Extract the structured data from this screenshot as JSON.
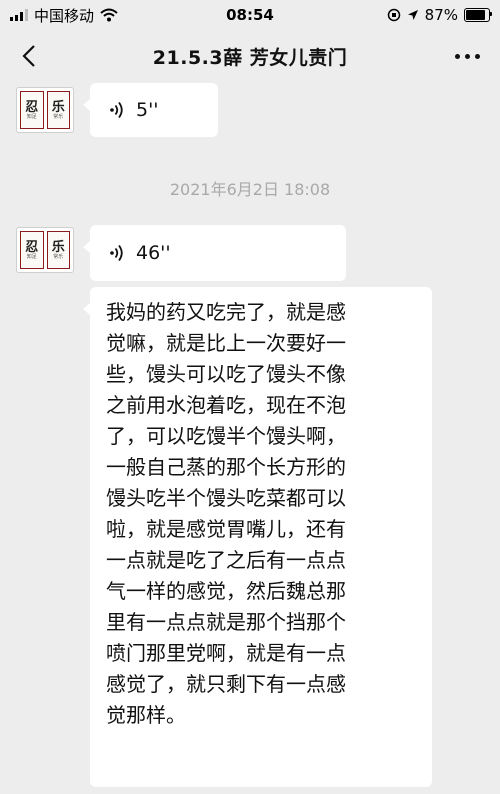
{
  "status_bar": {
    "carrier": "中国移动",
    "time": "08:54",
    "battery": "87%",
    "battery_level": 0.87
  },
  "header": {
    "title": "21.5.3薛  芳女儿责门",
    "back_icon": "chevron-left-icon",
    "more_icon": "more-dots-icon"
  },
  "messages": [
    {
      "type": "voice",
      "duration": "5''"
    },
    {
      "type": "timestamp",
      "text": "2021年6月2日 18:08"
    },
    {
      "type": "voice",
      "duration": "46''"
    },
    {
      "type": "text",
      "lines": [
        "我妈的药又吃完了，就是感",
        "觉嘛，就是比上一次要好一",
        "些，馒头可以吃了馒头不像",
        "之前用水泡着吃，现在不泡",
        "了，可以吃馒半个馒头啊，",
        "一般自己蒸的那个长方形的",
        "馒头吃半个馒头吃菜都可以",
        "啦，就是感觉胃嘴儿，还有",
        "一点就是吃了之后有一点点",
        "气一样的感觉，然后魏总那",
        "里有一点点就是那个挡那个",
        "喷门那里党啊，就是有一点",
        "感觉了，就只剩下有一点感",
        "觉那样。"
      ]
    }
  ],
  "avatar": {
    "left_char": "忍",
    "right_char": "乐"
  }
}
